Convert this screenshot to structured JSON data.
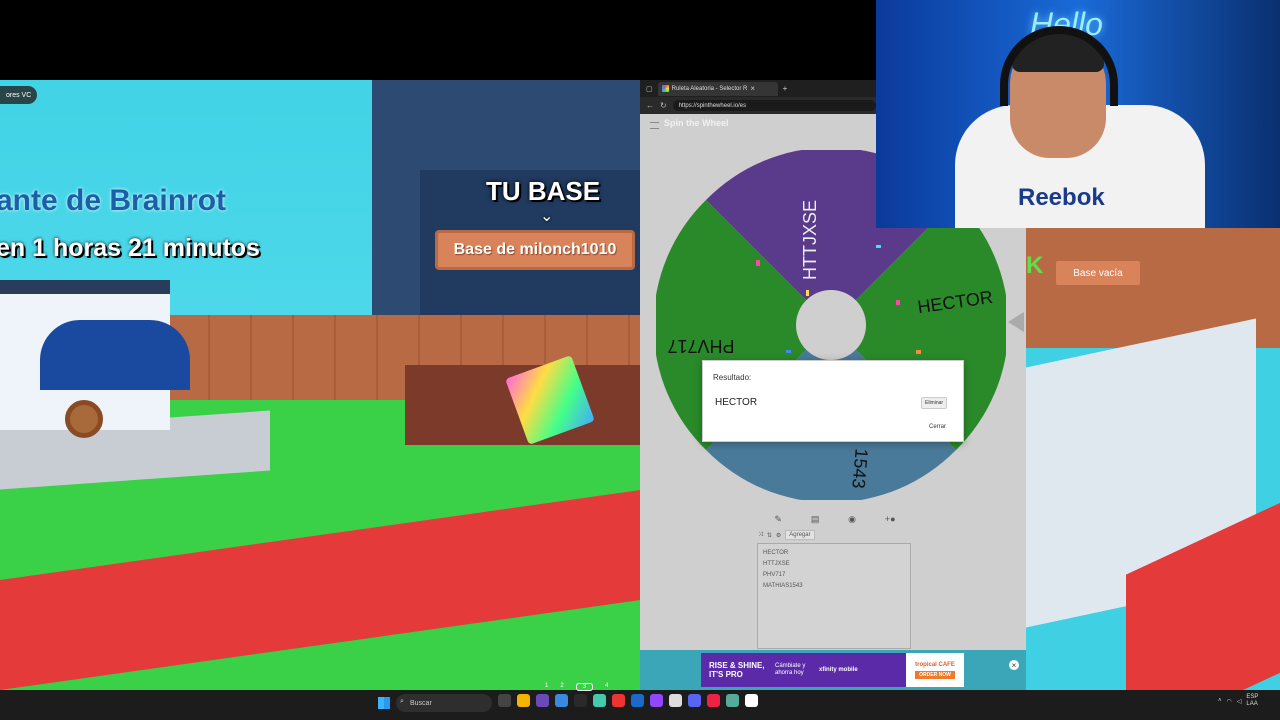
{
  "game": {
    "vc_badge": "ores VC",
    "title_line1": "ante de Brainrot",
    "title_line2": "en 1 horas 21 minutos",
    "tu_base": "TU BASE",
    "base_sign": "Base de milonch1010"
  },
  "game_right": {
    "base_sign": "Base vacía",
    "letter": "K"
  },
  "browser": {
    "tab_title": "Ruleta Aleatoria - Selector R",
    "tab_close": "×",
    "new_tab": "+",
    "url": "https://spinthewheel.io/es",
    "logo": "Spin the Wheel"
  },
  "wheel": {
    "segments": [
      {
        "label": "HTTJXSE",
        "color": "#5a3a8a"
      },
      {
        "label": "HECTOR",
        "color": "#2a8a2a"
      },
      {
        "label": "MATHIAS1543",
        "color": "#4a7a9a"
      },
      {
        "label": "PHV717",
        "color": "#2a8a2a"
      }
    ],
    "visible_labels": {
      "httjxse": "HTTJXSE",
      "hector": "HECTOR",
      "phv717": "PHV717",
      "mathias": "1543"
    }
  },
  "dialog": {
    "label": "Resultado:",
    "value": "HECTOR",
    "remove": "Eliminar",
    "close": "Cerrar"
  },
  "editor": {
    "add_label": "Agregar",
    "entries": [
      "HECTOR",
      "HTTJXSE",
      "PHV717",
      "MATHIAS1543"
    ]
  },
  "ad": {
    "headline": "RISE & SHINE, IT'S PRO",
    "sub": "Cámbiate y ahorra hoy",
    "brand": "xfinity mobile",
    "cafe": "tropical CAFE",
    "order": "ORDER NOW",
    "close": "×"
  },
  "webcam": {
    "neon": "Hello",
    "hoodie": "Reebok"
  },
  "taskbar": {
    "search_placeholder": "Buscar",
    "pager": [
      "1",
      "2",
      "3",
      "4"
    ],
    "tray_lang": "ESP LAA"
  }
}
